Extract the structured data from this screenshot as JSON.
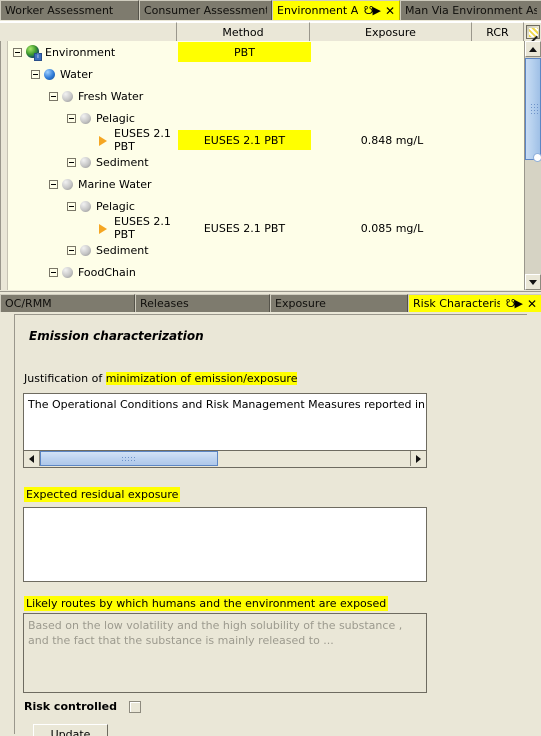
{
  "top_panel": {
    "tabs": [
      {
        "label": "Worker Assessment",
        "active": false
      },
      {
        "label": "Consumer Assessment",
        "active": false
      },
      {
        "label": "Environment Asse...",
        "active": true
      },
      {
        "label": "Man Via Environment As...",
        "active": false
      }
    ],
    "tab_float_icon": "float-window-icon",
    "tab_close_icon": "close-icon",
    "columns": [
      "",
      "Method",
      "Exposure",
      "RCR"
    ],
    "header_tool_icon": "column-settings-icon",
    "rows": [
      {
        "indent": 0,
        "expander": "minus",
        "icon": "globe-icon",
        "name": "Environment",
        "method": "PBT",
        "method_highlight": true,
        "exposure": "",
        "rcr": ""
      },
      {
        "indent": 1,
        "expander": "minus",
        "icon": "blue-sphere-icon",
        "name": "Water",
        "method": "",
        "method_highlight": false,
        "exposure": "",
        "rcr": ""
      },
      {
        "indent": 2,
        "expander": "minus",
        "icon": "gray-sphere-icon",
        "name": "Fresh Water",
        "method": "",
        "method_highlight": false,
        "exposure": "",
        "rcr": ""
      },
      {
        "indent": 3,
        "expander": "minus",
        "icon": "gray-sphere-icon",
        "name": "Pelagic",
        "method": "",
        "method_highlight": false,
        "exposure": "",
        "rcr": ""
      },
      {
        "indent": 4,
        "expander": "none",
        "icon": "orange-arrow-icon",
        "name": "EUSES 2.1 PBT",
        "method": "EUSES 2.1 PBT",
        "method_highlight": true,
        "exposure": "0.848 mg/L",
        "rcr": ""
      },
      {
        "indent": 3,
        "expander": "minus",
        "icon": "gray-sphere-icon",
        "name": "Sediment",
        "method": "",
        "method_highlight": false,
        "exposure": "",
        "rcr": ""
      },
      {
        "indent": 2,
        "expander": "minus",
        "icon": "gray-sphere-icon",
        "name": "Marine Water",
        "method": "",
        "method_highlight": false,
        "exposure": "",
        "rcr": ""
      },
      {
        "indent": 3,
        "expander": "minus",
        "icon": "gray-sphere-icon",
        "name": "Pelagic",
        "method": "",
        "method_highlight": false,
        "exposure": "",
        "rcr": ""
      },
      {
        "indent": 4,
        "expander": "none",
        "icon": "orange-arrow-icon",
        "name": "EUSES 2.1 PBT",
        "method": "EUSES 2.1 PBT",
        "method_highlight": false,
        "exposure": "0.085 mg/L",
        "rcr": ""
      },
      {
        "indent": 3,
        "expander": "minus",
        "icon": "gray-sphere-icon",
        "name": "Sediment",
        "method": "",
        "method_highlight": false,
        "exposure": "",
        "rcr": ""
      },
      {
        "indent": 2,
        "expander": "minus",
        "icon": "gray-sphere-icon",
        "name": "FoodChain",
        "method": "",
        "method_highlight": false,
        "exposure": "",
        "rcr": ""
      }
    ],
    "scrollbar": {
      "up_icon": "scroll-up-icon",
      "down_icon": "scroll-down-icon"
    }
  },
  "bottom_panel": {
    "tabs": [
      {
        "label": "OC/RMM",
        "active": false
      },
      {
        "label": "Releases",
        "active": false
      },
      {
        "label": "Exposure",
        "active": false
      },
      {
        "label": "Risk Characterisa...",
        "active": true
      }
    ],
    "tab_float_icon": "float-window-icon",
    "tab_close_icon": "close-icon",
    "section_title": "Emission characterization",
    "justification": {
      "label_prefix": "Justification of ",
      "label_highlight": "minimization of emission/exposure",
      "value": "The Operational Conditions and Risk Management Measures reported in th"
    },
    "expected_residual": {
      "label": "Expected residual exposure",
      "value": ""
    },
    "likely_routes": {
      "label": "Likely routes by which humans and the environment are exposed",
      "placeholder": "Based on the low volatility and the high solubility of the substance , and the fact that the substance is mainly released to ..."
    },
    "risk_controlled": {
      "label": "Risk controlled",
      "checked": false
    },
    "update_button": "Update",
    "hscroll": {
      "left_icon": "scroll-left-icon",
      "right_icon": "scroll-right-icon"
    }
  },
  "colors": {
    "highlight": "#FFFF00",
    "panel_bg": "#EAE7D7",
    "tree_bg": "#FEFEE8",
    "tab_bg": "#7E7B6E"
  }
}
